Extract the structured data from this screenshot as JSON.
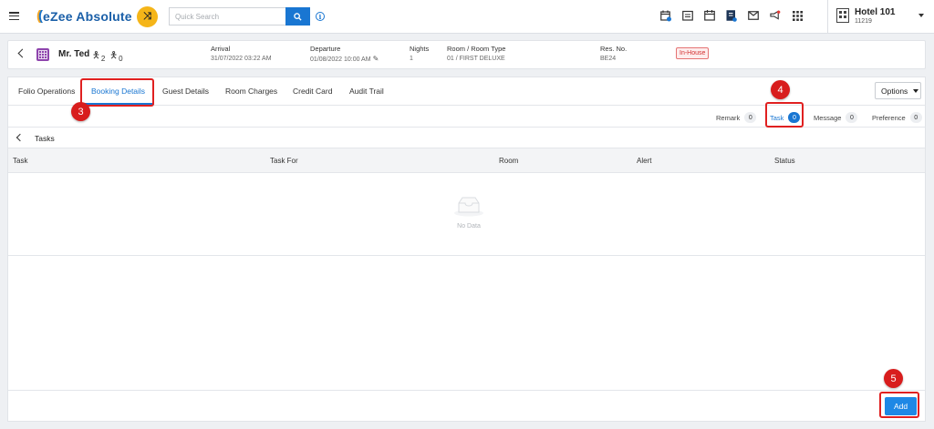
{
  "app": {
    "logo_text": "eZee Absolute",
    "search_placeholder": "Quick Search"
  },
  "hotel": {
    "name": "Hotel 101",
    "code": "11219"
  },
  "guest": {
    "name": "Mr. Ted",
    "adults": "2",
    "children": "0",
    "arrival_label": "Arrival",
    "arrival_value": "31/07/2022 03:22 AM",
    "departure_label": "Departure",
    "departure_value": "01/08/2022 10:00 AM",
    "nights_label": "Nights",
    "nights_value": "1",
    "room_label": "Room / Room Type",
    "room_value": "01 / FIRST DELUXE",
    "res_label": "Res. No.",
    "res_value": "BE24",
    "status": "In-House"
  },
  "tabs": [
    "Folio Operations",
    "Booking Details",
    "Guest Details",
    "Room Charges",
    "Credit Card",
    "Audit Trail"
  ],
  "options_label": "Options",
  "subtabs": [
    {
      "label": "Remark",
      "count": "0"
    },
    {
      "label": "Task",
      "count": "0"
    },
    {
      "label": "Message",
      "count": "0"
    },
    {
      "label": "Preference",
      "count": "0"
    }
  ],
  "section_title": "Tasks",
  "columns": [
    "Task",
    "Task For",
    "Room",
    "Alert",
    "Status"
  ],
  "empty_text": "No Data",
  "add_label": "Add",
  "annotations": [
    "3",
    "4",
    "5"
  ],
  "colors": {
    "primary": "#1976d2",
    "accent": "#f5b518",
    "annotation": "#d81d1d",
    "status_red": "#d32f2f"
  }
}
